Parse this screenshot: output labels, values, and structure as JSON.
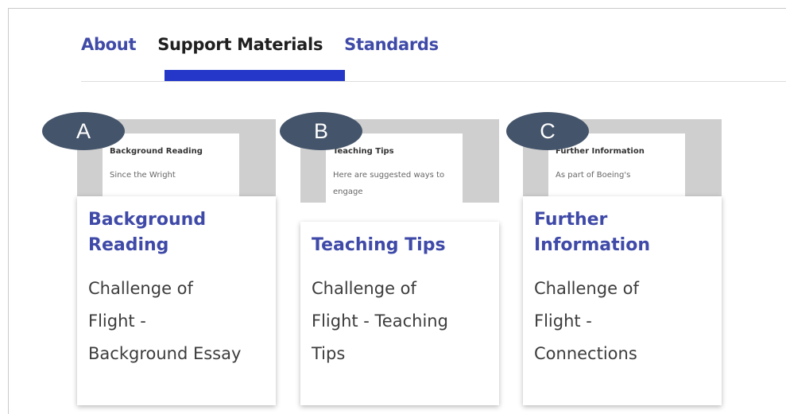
{
  "tabs": [
    {
      "label": "About",
      "active": false
    },
    {
      "label": "Support Materials",
      "active": true
    },
    {
      "label": "Standards",
      "active": false
    }
  ],
  "cards": [
    {
      "badge": "A",
      "thumb_title": "Background Reading",
      "thumb_text": "Since the Wright",
      "title_line1": "Background",
      "title_line2": "Reading",
      "desc_line1": "Challenge of",
      "desc_line2": "Flight -",
      "desc_line3": "Background Essay"
    },
    {
      "badge": "B",
      "thumb_title": "Teaching Tips",
      "thumb_text": "Here are suggested ways to engage",
      "title_line1": "Teaching Tips",
      "desc_line1": "Challenge of",
      "desc_line2": "Flight - Teaching",
      "desc_line3": "Tips"
    },
    {
      "badge": "C",
      "thumb_title": "Further Information",
      "thumb_text": "As part of Boeing's",
      "title_line1": "Further",
      "title_line2": "Information",
      "desc_line1": "Challenge of",
      "desc_line2": "Flight -",
      "desc_line3": "Connections"
    }
  ],
  "colors": {
    "accent": "#2437c8",
    "link": "#3f4aa8",
    "badge": "#44546a"
  }
}
